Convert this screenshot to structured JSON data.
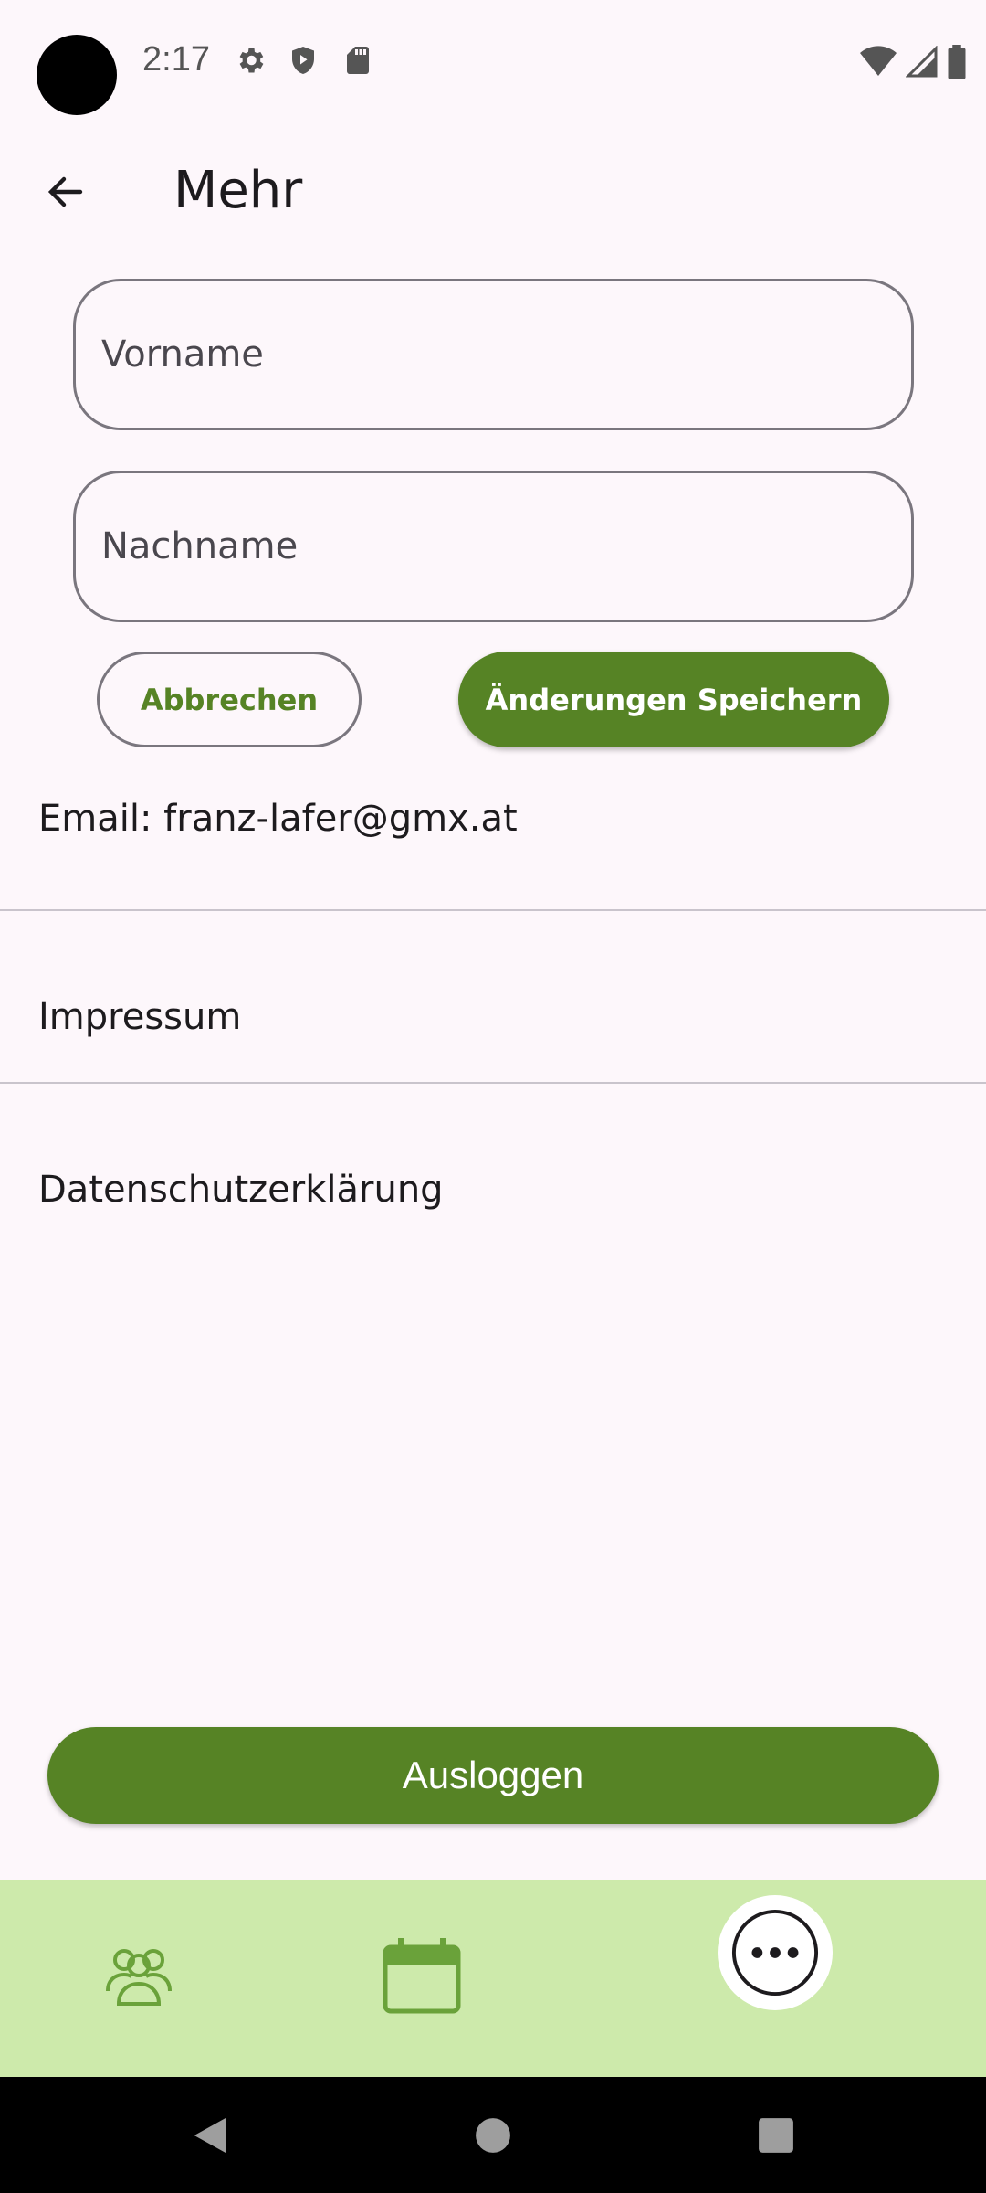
{
  "status_bar": {
    "time": "2:17",
    "icons_left": [
      "settings-icon",
      "shield-play-icon",
      "sd-card-icon"
    ],
    "icons_right": [
      "wifi-icon",
      "signal-icon",
      "battery-icon"
    ]
  },
  "app_bar": {
    "title": "Mehr",
    "back_icon": "arrow-back-icon"
  },
  "form": {
    "first_name": {
      "value": "",
      "placeholder": "Vorname"
    },
    "last_name": {
      "value": "",
      "placeholder": "Nachname"
    },
    "cancel_label": "Abbrechen",
    "save_label": "Änderungen Speichern"
  },
  "account": {
    "email_line": "Email: franz-lafer@gmx.at"
  },
  "links": [
    {
      "label": "Impressum"
    },
    {
      "label": "Datenschutzerklärung"
    }
  ],
  "logout_label": "Ausloggen",
  "bottom_nav": {
    "items": [
      {
        "icon": "people-icon",
        "active": false
      },
      {
        "icon": "calendar-icon",
        "active": false
      },
      {
        "icon": "more-horizontal-icon",
        "active": true
      }
    ]
  },
  "colors": {
    "primary": "#568325",
    "nav_background": "#cdeaab",
    "background": "#fdf7fb",
    "outline": "#7a767e"
  }
}
